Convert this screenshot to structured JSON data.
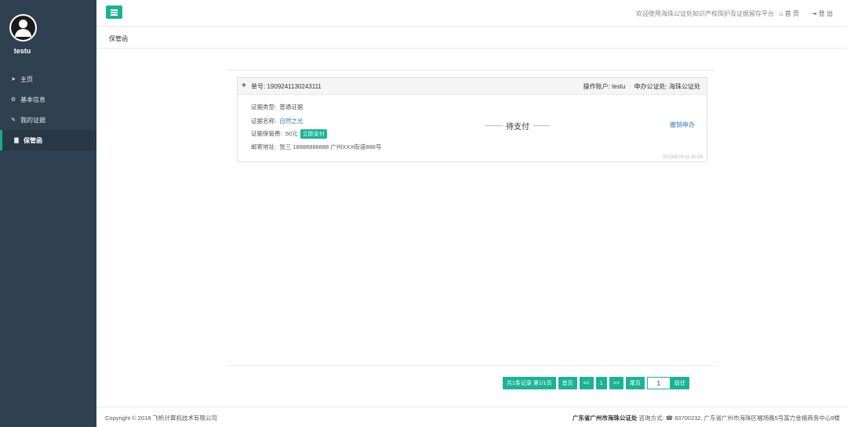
{
  "user": {
    "name": "testu"
  },
  "sidebar": {
    "items": [
      {
        "icon": "send-icon",
        "label": "主页"
      },
      {
        "icon": "gear-icon",
        "label": "基本信息"
      },
      {
        "icon": "wrench-icon",
        "label": "我的证据"
      },
      {
        "icon": "document-icon",
        "label": "保管函",
        "active": true
      }
    ]
  },
  "topbar": {
    "welcome": "欢迎使用海珠公证处知识产权保护及证据留存平台",
    "home_label": "首 页",
    "logout_label": "登 出"
  },
  "page": {
    "title": "保管函"
  },
  "record": {
    "order_label": "单号:",
    "order_no": "1909241130243111",
    "operator_label": "操作账户:",
    "operator": "testu",
    "office_label": "申办公证处:",
    "office": "海珠公证处",
    "type_label": "证据类型:",
    "type": "普通证据",
    "name_label": "证据名称:",
    "name": "自然之光",
    "fee_label": "证据保管费:",
    "fee": "50元",
    "pay_button": "立即支付",
    "address_label": "邮寄地址:",
    "address": "张三 18888888888 广州XXX街道888号",
    "status": "待支付",
    "cancel_label": "撤销申办",
    "timestamp": "2019/9/24 11:30:24"
  },
  "pagination": {
    "summary": "共1条记录 第1/1页",
    "first": "首页",
    "prev": "<<",
    "current": "1",
    "next": ">>",
    "last": "尾页",
    "input_value": "1",
    "go": "前往"
  },
  "footer": {
    "copyright": "Copyright © 2018 飞帆计算机技术有限公司",
    "org": "广东省广州市海珠公证处",
    "contact": " 咨询方式: ☎ 83700232,  广东省广州市海珠区福场路5号富力金禧商务中心9楼"
  },
  "colors": {
    "sidebar": "#2f4050",
    "accent": "#1ab394",
    "link": "#337ab7"
  }
}
